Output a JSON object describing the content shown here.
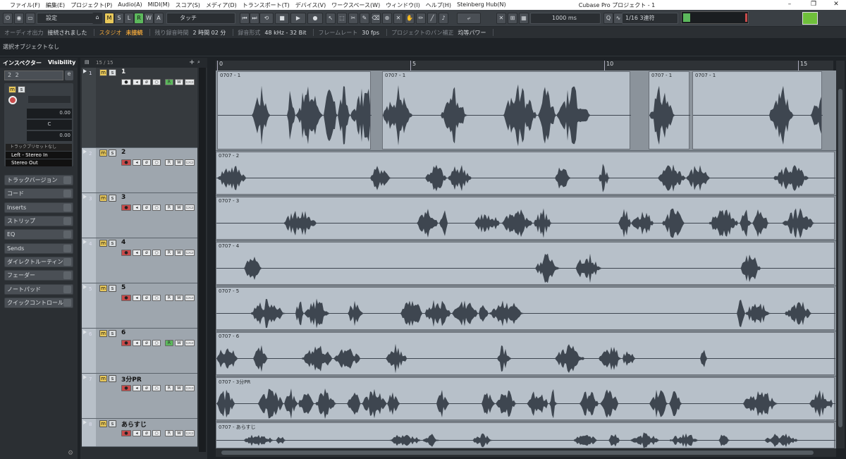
{
  "menu": [
    "ファイル(F)",
    "編集(E)",
    "プロジェクト(P)",
    "Audio(A)",
    "MIDI(M)",
    "スコア(S)",
    "メディア(D)",
    "トランスポート(T)",
    "デバイス(V)",
    "ワークスペース(W)",
    "ウィンドウ(I)",
    "ヘルプ(H)",
    "Steinberg Hub(N)"
  ],
  "window_title": "Cubase Pro プロジェクト - 1",
  "toolbar": {
    "preset": "設定",
    "mode_buttons": [
      "M",
      "S",
      "L",
      "R",
      "W",
      "A"
    ],
    "automation_mode": "タッチ",
    "snap_value": "1000 ms",
    "quantize": "1/16  3連符"
  },
  "status": {
    "audio_label": "オーディオ出力",
    "audio_value": "接続されました",
    "studio_label": "スタジオ",
    "studio_value": "未接続",
    "rec_label": "残り録音時間",
    "rec_value": "2 時間 02 分",
    "format_label": "録音形式",
    "format_value": "48 kHz - 32 Bit",
    "frame_label": "フレームレート",
    "frame_value": "30 fps",
    "pan_label": "プロジェクトのパン補正",
    "pan_value": "均等パワー"
  },
  "info_line": "選択オブジェクトなし",
  "inspector": {
    "tab_inspector": "インスペクター",
    "tab_visibility": "Visibility",
    "track_name": "2",
    "track_num": "2",
    "vol_value": "0.00",
    "pan_value": "C",
    "delay_value": "0.00",
    "preset_label": "トラックプリセットなし",
    "input": "Left - Stereo In",
    "output": "Stereo Out",
    "sections": [
      "トラックバージョン",
      "コード",
      "Inserts",
      "ストリップ",
      "EQ",
      "Sends",
      "ダイレクトルーティング",
      "フェーダー",
      "ノートパッド",
      "クイックコントロール"
    ]
  },
  "tracklist": {
    "count": "15 / 15",
    "tracks": [
      {
        "num": "1",
        "name": "1"
      },
      {
        "num": "2",
        "name": "2"
      },
      {
        "num": "3",
        "name": "3"
      },
      {
        "num": "4",
        "name": "4"
      },
      {
        "num": "5",
        "name": "5"
      },
      {
        "num": "6",
        "name": "6"
      },
      {
        "num": "7",
        "name": "3分PR"
      },
      {
        "num": "8",
        "name": "あらすじ"
      }
    ]
  },
  "ruler": [
    "0",
    "5",
    "10",
    "15"
  ],
  "clips": [
    [
      "0707 - 1",
      "0707 - 1",
      "0707 - 1",
      "0707 - 1"
    ],
    [
      "0707 - 2"
    ],
    [
      "0707 - 3"
    ],
    [
      "0707 - 4"
    ],
    [
      "0707 - 5"
    ],
    [
      "0707 - 6"
    ],
    [
      "0707 - 3分PR"
    ],
    [
      "0707 - あらすじ"
    ]
  ],
  "colors": {
    "accent_orange": "#e8a23a",
    "green": "#5cb85c",
    "clip": "#b7c0c9",
    "wave": "#3e4650"
  },
  "icons": [
    "minimize-icon",
    "maximize-icon",
    "close-icon",
    "record-icon",
    "play-icon",
    "stop-icon",
    "cycle-icon",
    "arrow-tool-icon",
    "search-icon",
    "gear-icon"
  ]
}
